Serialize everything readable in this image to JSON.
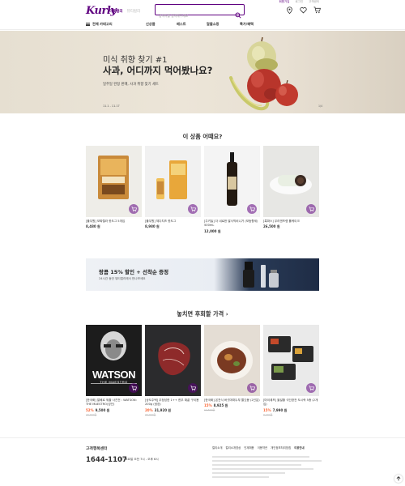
{
  "top_links": [
    "회원가입",
    "로그인",
    "고객센터"
  ],
  "header": {
    "logo": "Kurly",
    "mode_tabs": [
      "마켓컬리",
      "뷰티컬리"
    ],
    "search_placeholder": "검색어를 입력해주세요"
  },
  "gnb": {
    "category": "전체 카테고리",
    "menu": [
      "신상품",
      "베스트",
      "알뜰쇼핑",
      "특가/혜택"
    ]
  },
  "banner": {
    "subtitle": "미식 취향 찾기 #1",
    "title": "사과, 어디까지 먹어봤나요?",
    "desc": "일주일 완정 판매, 사과 취향 찾기 세트",
    "date": "11.1 - 11.17",
    "page": "1/4"
  },
  "section1": {
    "title": "이 상품 어때요?",
    "products": [
      {
        "name": "[풀무원] 모짜렐라 핫도그 5개입",
        "price": "8,480 원"
      },
      {
        "name": "[풀무원] 체다치즈 핫도그",
        "price": "8,980 원"
      },
      {
        "name": "[주키놀] 더 네로한 발사믹비니거 (모듬향세) 500mL",
        "price": "12,000 원"
      },
      {
        "name": "[룩파스] 우리엔프렙 롤케이크",
        "price": "26,500 원"
      }
    ]
  },
  "promo": {
    "title": "랑콤 15% 할인 + 선착순 증정",
    "sub": "24시간 동안 뷰티컬리에서 만나보세요"
  },
  "section2": {
    "title": "놓치면 후회할 가격",
    "products": [
      {
        "name": "[한국화] 알베르 워홀 사진전 : WATSON: THE MAESTRO(성인)",
        "discount": "52%",
        "price": "9,500 원",
        "original": "20,000원",
        "poster_text": "WATSON",
        "poster_sub": "THE MAESTRO"
      },
      {
        "name": "[상도주택] 우정성한 1++ 한우 채끝 구이용 200g (냉장)",
        "discount": "20%",
        "price": "31,920 원",
        "original": "39,900원"
      },
      {
        "name": "[한국화] 온천식 버섯마파두부 쫄깃봉 (2인분)",
        "discount": "15%",
        "price": "8,925 원",
        "original": "10,500원"
      },
      {
        "name": "[마이셰프] 올설할 식단완전 도시락 5종 (2개입)",
        "discount": "15%",
        "price": "7,990 원",
        "original": "9,400원"
      }
    ]
  },
  "footer": {
    "cs_title": "고객행복센터",
    "phone": "1644-1107",
    "hours": "월~토요일 오전 7시 - 오후 6시",
    "links": [
      "컬리소개",
      "컬리소개영상",
      "인재채용",
      "이용약관",
      "개인정보처리방침",
      "이용안내"
    ]
  },
  "colors": {
    "brand": "#5f0080",
    "discount": "#fa622f"
  }
}
